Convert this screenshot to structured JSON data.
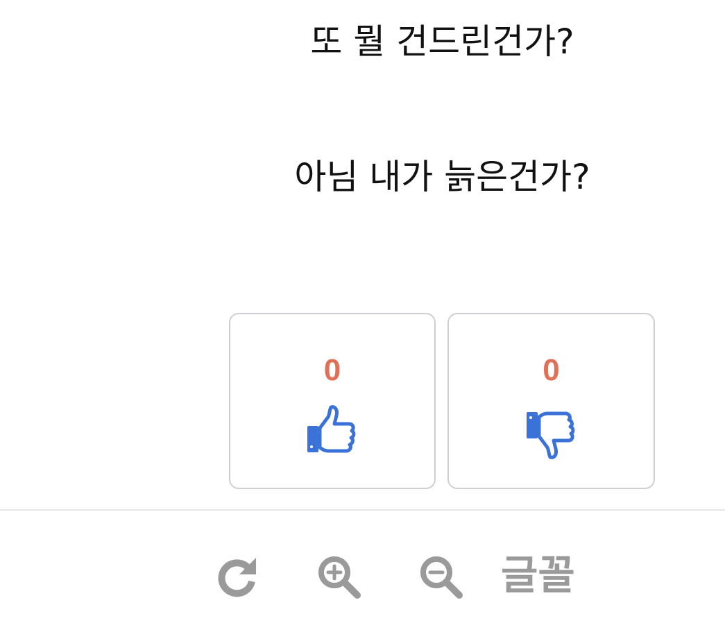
{
  "post": {
    "line1": "또 뭘 건드린건가?",
    "line2": "아님 내가 늙은건가?"
  },
  "votes": {
    "up_count": "0",
    "down_count": "0",
    "count_color": "#e07058",
    "icon_color": "#3a72d8",
    "up_icon": "thumbs-up-icon",
    "down_icon": "thumbs-down-icon"
  },
  "toolbar": {
    "refresh_icon": "refresh-icon",
    "zoom_in_icon": "zoom-in-icon",
    "zoom_out_icon": "zoom-out-icon",
    "font_label": "글꼴",
    "icon_color": "#9a9a9a"
  }
}
